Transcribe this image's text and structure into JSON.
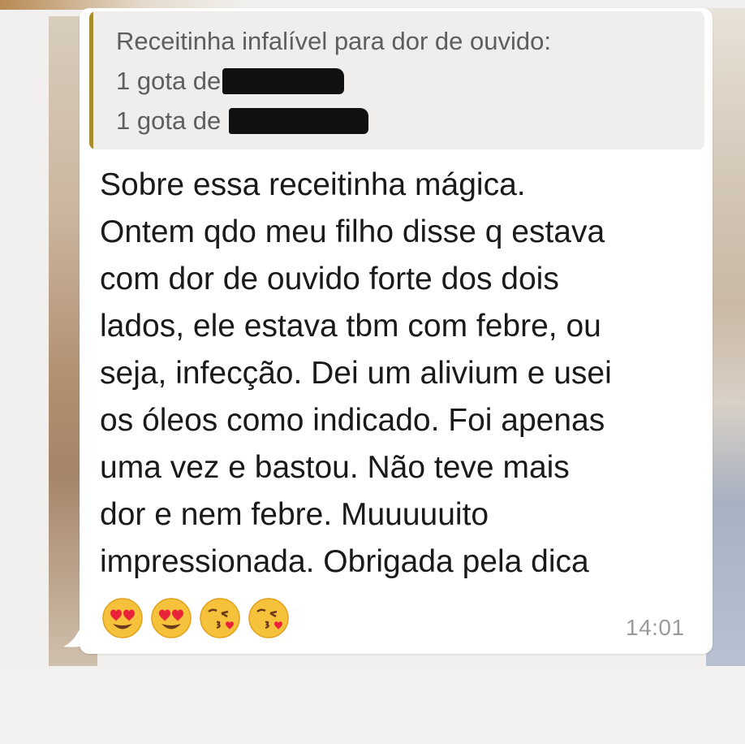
{
  "quote": {
    "lines": [
      "Receitinha infalível para dor de ouvido:",
      "1 gota de",
      "1 gota de"
    ]
  },
  "message": {
    "lines": [
      "Sobre essa receitinha mágica.",
      "Ontem qdo meu filho disse q estava",
      "com dor de ouvido forte dos dois",
      "lados, ele estava tbm com febre, ou",
      "seja, infecção. Dei um alivium e usei",
      "os óleos como indicado. Foi apenas",
      "uma vez e bastou. Não teve mais",
      "dor e nem febre. Muuuuuito",
      "impressionada. Obrigada pela dica"
    ],
    "emojis": [
      "heart-eyes-icon",
      "heart-eyes-icon",
      "kissing-heart-icon",
      "kissing-heart-icon"
    ],
    "timestamp": "14:01"
  },
  "colors": {
    "quote_bar": "#a88d2c",
    "bubble": "#ffffff",
    "quote_bg": "#efeeed",
    "timestamp": "#9b9b9b"
  }
}
